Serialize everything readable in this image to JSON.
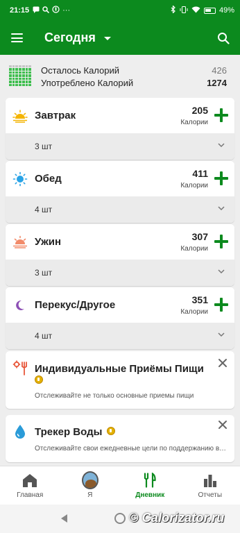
{
  "status_bar": {
    "time": "21:15",
    "icons_left": [
      "message-icon",
      "search-icon",
      "app-icon",
      "more-icon"
    ],
    "more_glyph": "···",
    "icons_right": [
      "bluetooth-icon",
      "vibrate-icon",
      "wifi-icon",
      "battery-icon"
    ],
    "battery": "49%"
  },
  "app_bar": {
    "title": "Сегодня",
    "color": "#0c8a1e"
  },
  "summary": {
    "remaining_label": "Осталось Калорий",
    "remaining_value": "426",
    "consumed_label": "Употреблено Калорий",
    "consumed_value": "1274"
  },
  "meals": [
    {
      "name": "Завтрак",
      "calories": "205",
      "calories_label": "Калории",
      "count": "3 шт",
      "icon": "sunrise-icon"
    },
    {
      "name": "Обед",
      "calories": "411",
      "calories_label": "Калории",
      "count": "4 шт",
      "icon": "sun-icon"
    },
    {
      "name": "Ужин",
      "calories": "307",
      "calories_label": "Калории",
      "count": "3 шт",
      "icon": "sunset-icon"
    },
    {
      "name": "Перекус/Другое",
      "calories": "351",
      "calories_label": "Калории",
      "count": "4 шт",
      "icon": "moon-icon"
    }
  ],
  "promos": [
    {
      "title": "Индивидуальные Приёмы Пищи",
      "subtitle": "Отслеживайте не только основные приемы пищи",
      "icon": "custom-meals-icon"
    },
    {
      "title": "Трекер Воды",
      "subtitle": "Отслеживайте свои ежедневные цели по поддержанию водного баланса",
      "icon": "water-drop-icon"
    }
  ],
  "bottom_nav": [
    {
      "label": "Главная",
      "icon": "home-icon",
      "active": false
    },
    {
      "label": "Я",
      "icon": "avatar-icon",
      "active": false
    },
    {
      "label": "Дневник",
      "icon": "cutlery-icon",
      "active": true
    },
    {
      "label": "Отчеты",
      "icon": "bar-chart-icon",
      "active": false
    }
  ],
  "watermark": "© Calorizator.ru"
}
